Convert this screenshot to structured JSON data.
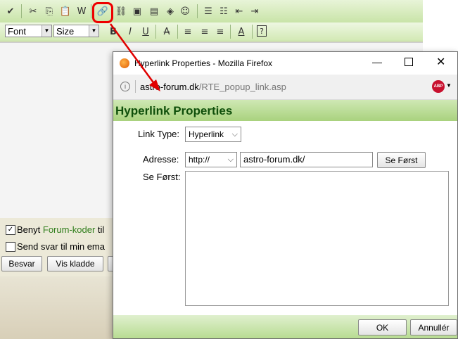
{
  "editor": {
    "font_select": "Font",
    "size_select": "Size",
    "checkbox1_label_prefix": "Benyt",
    "checkbox1_link": "Forum-koder",
    "checkbox1_label_suffix": "til",
    "checkbox2_label": "Send svar til min ema",
    "buttons": [
      "Besvar",
      "Vis kladde"
    ]
  },
  "popup": {
    "window_title": "Hyperlink Properties - Mozilla Firefox",
    "url_domain": "astro-forum.dk",
    "url_path": "/RTE_popup_link.asp",
    "addon_badge": "ABP",
    "heading": "Hyperlink Properties",
    "link_type_label": "Link Type:",
    "link_type_value": "Hyperlink",
    "address_label": "Adresse:",
    "protocol_value": "http://",
    "address_value": "astro-forum.dk/",
    "preview_button": "Se Først",
    "preview_label": "Se Først:",
    "ok_button": "OK",
    "cancel_button": "Annullér"
  },
  "colors": {
    "highlight": "#e00000",
    "link_green": "#2e7d1a",
    "heading_green": "#0f4f0a"
  }
}
